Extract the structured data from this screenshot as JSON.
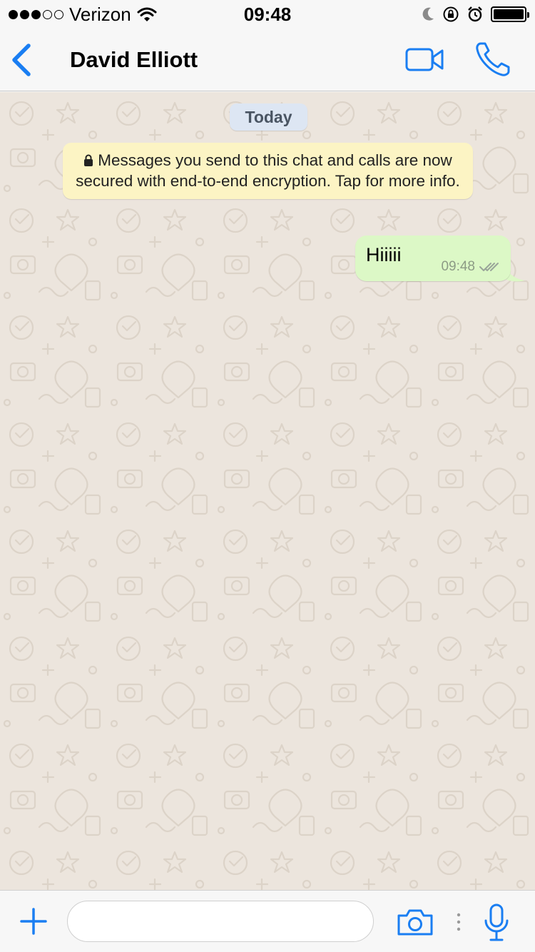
{
  "status_bar": {
    "carrier": "Verizon",
    "time": "09:48",
    "signal_bars_filled": 3,
    "signal_bars_total": 5,
    "battery_level": 1.0
  },
  "header": {
    "contact_name": "David Elliott",
    "back_icon": "chevron-left-icon",
    "video_call_icon": "video-camera-icon",
    "voice_call_icon": "phone-icon"
  },
  "chat": {
    "date_chip": "Today",
    "encryption_notice": "Messages you send to this chat and calls are now secured with end-to-end encryption. Tap for more info.",
    "messages": [
      {
        "direction": "outgoing",
        "text": "Hiiiii",
        "time": "09:48",
        "status": "delivered"
      }
    ]
  },
  "input_bar": {
    "message_value": "",
    "message_placeholder": ""
  },
  "colors": {
    "accent": "#1a7ef2",
    "chat_background": "#ece5dd",
    "outgoing_bubble": "#dcf8c6",
    "notice_background": "#fcf4c4",
    "date_chip_background": "#dde6f3"
  }
}
